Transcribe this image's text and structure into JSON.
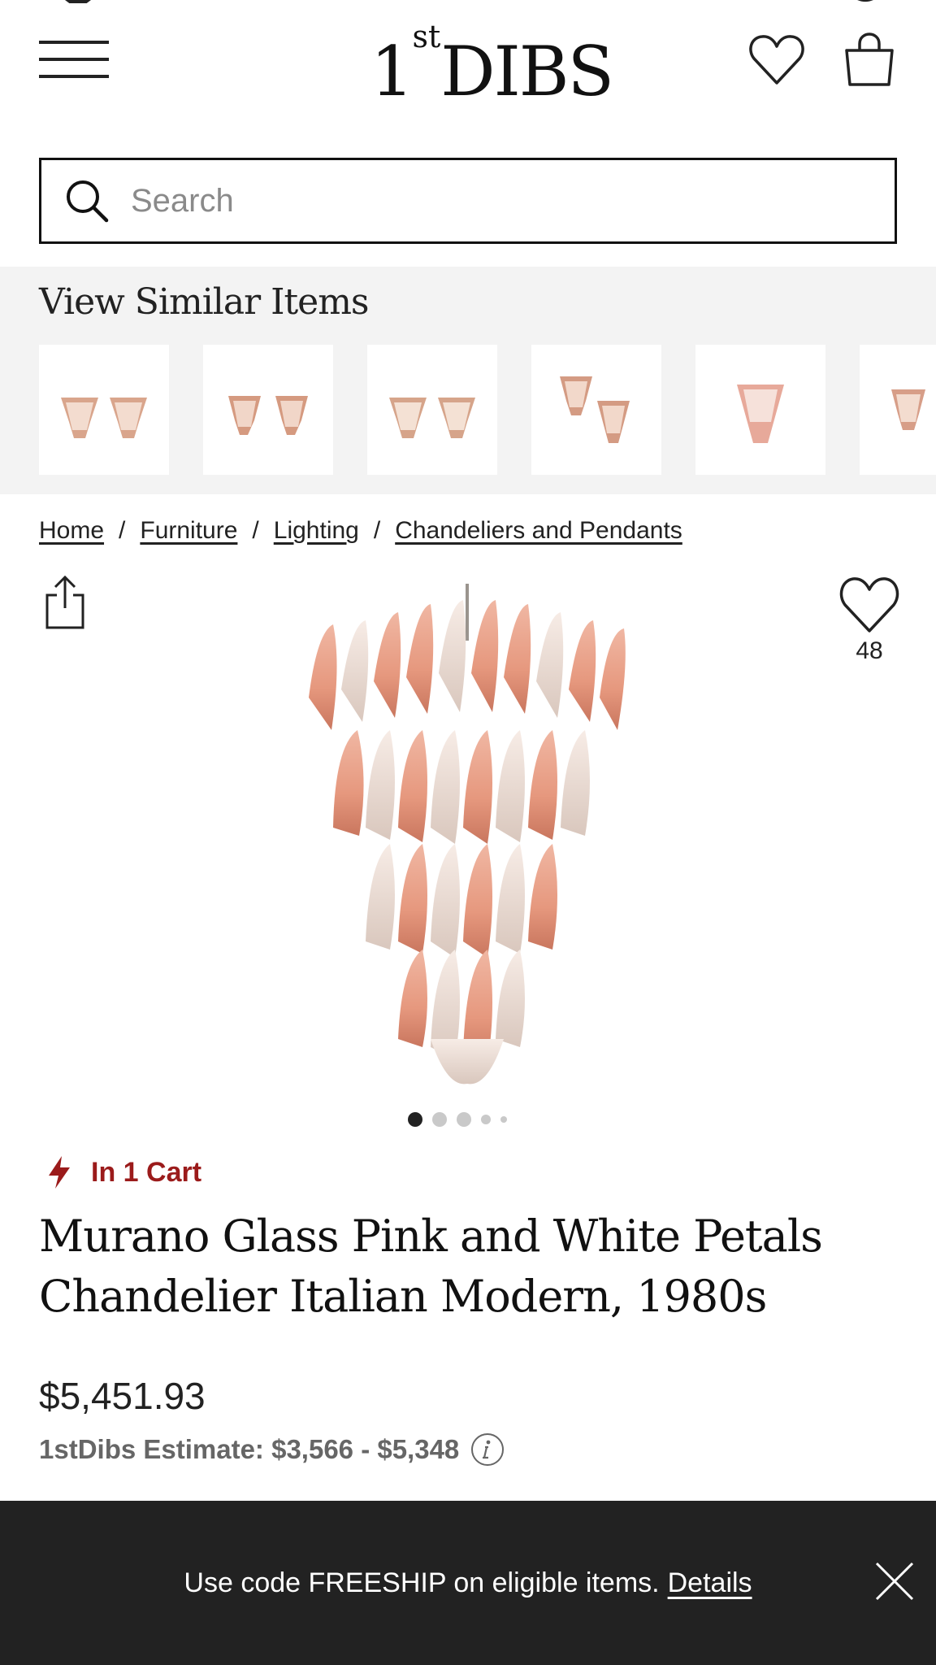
{
  "header": {
    "logo_main": "1",
    "logo_sup": "st",
    "logo_rest": "DIBS",
    "menu_icon": "hamburger-menu-icon",
    "favorites_icon": "heart-icon",
    "cart_icon": "shopping-bag-icon"
  },
  "search": {
    "placeholder": "Search",
    "icon": "search-icon"
  },
  "similar": {
    "title": "View Similar Items",
    "item_count_visible": 6
  },
  "breadcrumb": {
    "items": [
      "Home",
      "Furniture",
      "Lighting",
      "Chandeliers and Pendants"
    ],
    "separator": "/"
  },
  "product": {
    "favorite_count": "48",
    "in_cart_text": "In 1 Cart",
    "title_line1": "Murano Glass Pink and White Petals",
    "title_line2": "Chandelier Italian Modern, 1980s",
    "price": "$5,451.93",
    "estimate": "1stDibs Estimate: $3,566 - $5,348",
    "image_count": 5,
    "active_image": 1
  },
  "promo": {
    "text": "Use code FREESHIP on eligible items.",
    "link": "Details"
  },
  "colors": {
    "accent_red": "#9b1b1b",
    "promo_bg": "#222222",
    "similar_bg": "#f3f3f3",
    "glass_pink": "#e8a08a"
  }
}
